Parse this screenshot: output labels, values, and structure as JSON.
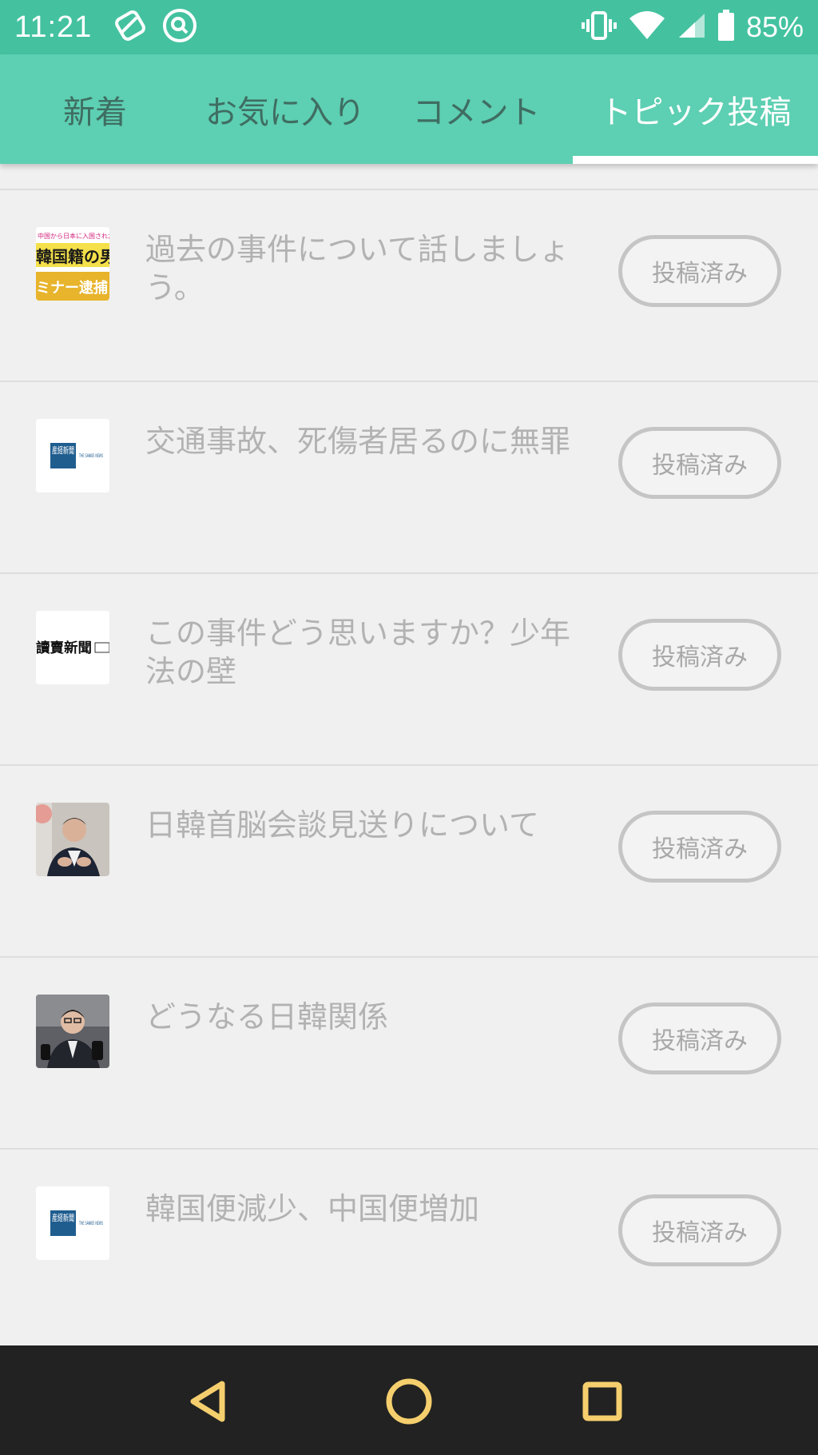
{
  "status_bar": {
    "time": "11:21",
    "battery": "85%",
    "icons": [
      "sync-icon",
      "search-circle-icon",
      "vibrate-icon",
      "wifi-icon",
      "signal-icon",
      "battery-icon"
    ]
  },
  "tabs": [
    {
      "label": "新着",
      "active": false
    },
    {
      "label": "お気に入り",
      "active": false
    },
    {
      "label": "コメント",
      "active": false
    },
    {
      "label": "トピック投稿",
      "active": true
    }
  ],
  "items": [
    {
      "title": "過去の事件について話しましょう。",
      "button": "投稿済み",
      "thumb": "news-clip-thumbnail"
    },
    {
      "title": "交通事故、死傷者居るのに無罪",
      "button": "投稿済み",
      "thumb": "sankei-news-logo"
    },
    {
      "title": "この事件どう思いますか？少年法の壁",
      "button": "投稿済み",
      "thumb": "newspaper-logo"
    },
    {
      "title": "日韓首脳会談見送りについて",
      "button": "投稿済み",
      "thumb": "politician-photo"
    },
    {
      "title": "どうなる日韓関係",
      "button": "投稿済み",
      "thumb": "press-photo"
    },
    {
      "title": "韓国便減少、中国便増加",
      "button": "投稿済み",
      "thumb": "sankei-news-logo"
    }
  ],
  "thumb_texts": {
    "clip_top": "中国から日本に入国された",
    "clip_main": "韓国籍の男",
    "clip_bottom": "ミナー逮捕",
    "sankei_kanji": "産経新聞",
    "sankei_en": "THE SANKEI NEWS",
    "newspaper_name": "讀賣新聞"
  },
  "nav": {
    "icons": [
      "back-icon",
      "home-icon",
      "recents-icon"
    ]
  },
  "colors": {
    "status_bar": "#44c2a0",
    "tab_bar": "#5dcfb2",
    "active_tab": "#ffffff",
    "inactive_tab": "#3f6d62",
    "nav_icon": "#f5cf6d"
  }
}
